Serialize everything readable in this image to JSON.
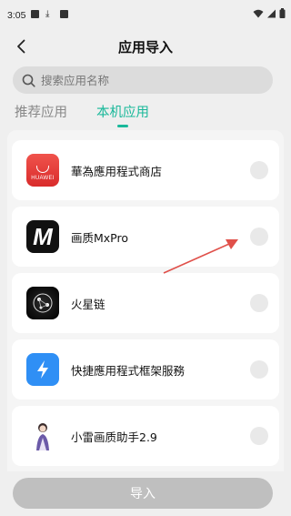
{
  "status_bar": {
    "time": "3:05"
  },
  "header": {
    "title": "应用导入"
  },
  "search": {
    "placeholder": "搜索应用名称"
  },
  "tabs": [
    {
      "label": "推荐应用",
      "active": false
    },
    {
      "label": "本机应用",
      "active": true
    }
  ],
  "apps": [
    {
      "name": "華為應用程式商店",
      "icon": "huawei-appgallery-icon",
      "icon_text": "HUAWEI",
      "selected": false
    },
    {
      "name": "画质MxPro",
      "icon": "mxpro-icon",
      "icon_text": "M",
      "selected": false
    },
    {
      "name": "火星链",
      "icon": "mars-chain-icon",
      "selected": false
    },
    {
      "name": "快捷應用程式框架服務",
      "icon": "quick-app-icon",
      "selected": false
    },
    {
      "name": "小雷画质助手2.9",
      "icon": "avatar-character-icon",
      "selected": false
    }
  ],
  "footer": {
    "import_label": "导入"
  },
  "colors": {
    "accent": "#19b89a",
    "annotation_arrow": "#e0504a",
    "button_disabled": "#bfbfbf"
  }
}
